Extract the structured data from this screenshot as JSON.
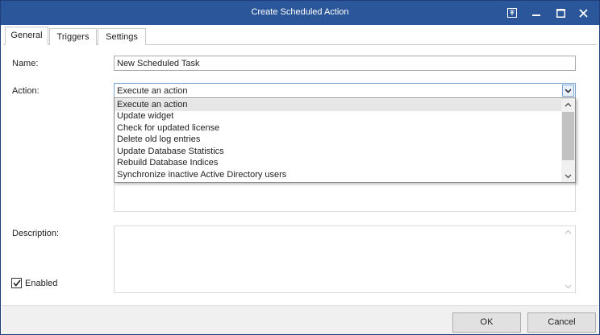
{
  "window": {
    "title": "Create Scheduled Action",
    "titlebar_color": "#2b579a",
    "buttons": [
      "restore-to-top-icon",
      "minimize-icon",
      "maximize-icon",
      "close-icon"
    ]
  },
  "tabs": [
    {
      "label": "General",
      "active": true
    },
    {
      "label": "Triggers",
      "active": false
    },
    {
      "label": "Settings",
      "active": false
    }
  ],
  "form": {
    "name_label": "Name:",
    "name_value": "New Scheduled Task",
    "action_label": "Action:",
    "action_value": "Execute an action",
    "description_label": "Description:",
    "description_value": "",
    "enabled_label": "Enabled",
    "enabled_checked": true
  },
  "action_dropdown": {
    "open": true,
    "selected_index": 0,
    "options": [
      "Execute an action",
      "Update widget",
      "Check for updated license",
      "Delete old log entries",
      "Update Database Statistics",
      "Rebuild Database Indices",
      "Synchronize inactive Active Directory users"
    ]
  },
  "footer": {
    "ok_label": "OK",
    "cancel_label": "Cancel"
  }
}
